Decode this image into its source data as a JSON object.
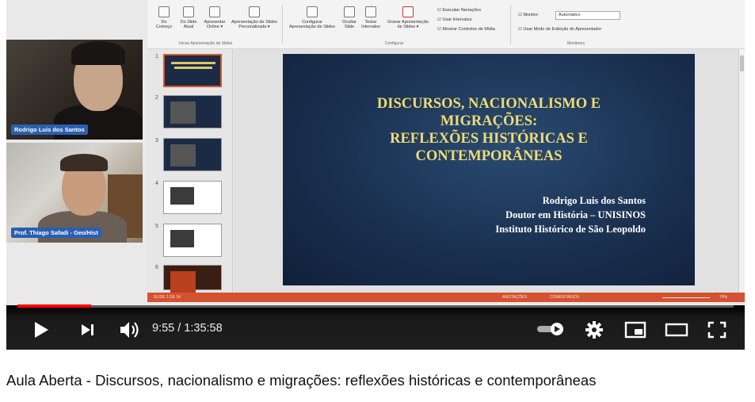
{
  "video": {
    "title": "Aula Aberta - Discursos, nacionalismo e migrações: reflexões históricas e contemporâneas",
    "time_current": "9:55",
    "time_total": "1:35:58",
    "time_display": "9:55 / 1:35:58",
    "progress_fraction": 0.103,
    "accent_color": "#ff0000"
  },
  "participants": [
    {
      "name": "Rodrigo Luis dos Santos"
    },
    {
      "name": "Prof. Thiago Safadi - Geo/Hist"
    }
  ],
  "ribbon": {
    "buttons": [
      {
        "label1": "Do",
        "label2": "Começo"
      },
      {
        "label1": "Do Slide",
        "label2": "Atual"
      },
      {
        "label1": "Apresentar",
        "label2": "Online ▾"
      },
      {
        "label1": "Apresentação de Slides",
        "label2": "Personalizada ▾"
      },
      {
        "label1": "Configurar",
        "label2": "Apresentação de Slides"
      },
      {
        "label1": "Ocultar",
        "label2": "Slide"
      },
      {
        "label1": "Testar",
        "label2": "Intervalos"
      },
      {
        "label1": "Gravar Apresentação",
        "label2": "de Slides ▾"
      }
    ],
    "groups": {
      "start": "Iniciar Apresentação de Slides",
      "setup": "Configurar",
      "monitors": "Monitores"
    },
    "checks": [
      "Executar Narrações",
      "Usar Intervalos",
      "Mostrar Controles de Mídia"
    ],
    "monitor_label": "Monitor:",
    "monitor_value": "Automático",
    "presenter_check": "Usar Modo de Exibição do Apresentador"
  },
  "thumbnails": [
    {
      "num": "1"
    },
    {
      "num": "2"
    },
    {
      "num": "3"
    },
    {
      "num": "4"
    },
    {
      "num": "5"
    },
    {
      "num": "6"
    }
  ],
  "slide": {
    "title_lines": [
      "DISCURSOS, NACIONALISMO E",
      "MIGRAÇÕES:",
      "REFLEXÕES HISTÓRICAS E",
      "CONTEMPORÂNEAS"
    ],
    "author_lines": [
      "Rodrigo Luis dos Santos",
      "Doutor em História – UNISINOS",
      "Instituto Histórico de São Leopoldo"
    ]
  },
  "statusbar": {
    "slide_info": "SLIDE 1 DE 14",
    "notes": "ANOTAÇÕES",
    "comments": "COMENTÁRIOS",
    "zoom": "74%"
  },
  "icons": [
    "play-icon",
    "next-icon",
    "volume-icon",
    "autoplay-toggle-icon",
    "settings-icon",
    "miniplayer-icon",
    "theater-icon",
    "fullscreen-icon"
  ]
}
